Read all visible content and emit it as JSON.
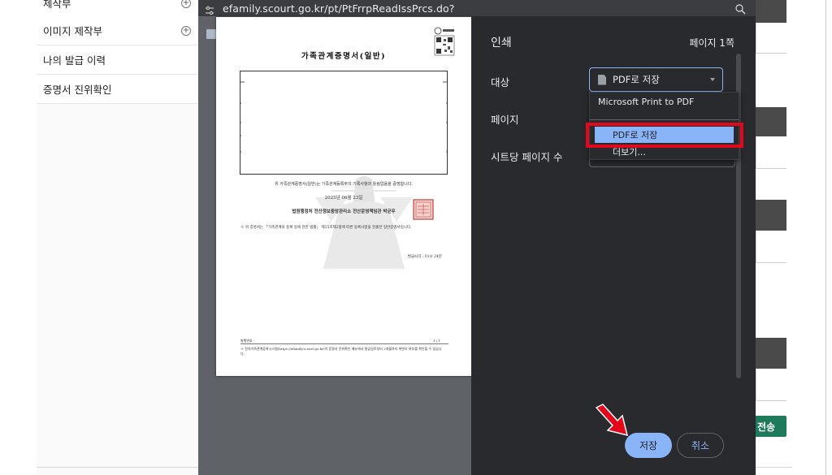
{
  "background": {
    "menu_items": [
      {
        "label": "제작부"
      },
      {
        "label": "이미지 제작부"
      },
      {
        "label": "나의 발급 이력"
      },
      {
        "label": "증명서 진위확인"
      }
    ],
    "send_button": "전송"
  },
  "browser": {
    "url": "efamily.scourt.go.kr/pt/PtFrrpReadIssPrcs.do?"
  },
  "preview": {
    "doc_title": "가족관계증명서(일반)",
    "line_statement": "위 가족관계증명서(일반)는 가족관계등록부의 기록사항과 틀림없음을 증명합니다.",
    "date": "2025년 06월 23일",
    "issuer": "법원행정처 전산정보중앙관리소 전산운영책임관 박균우",
    "note": "※ 위 증명서는 「가족관계의 등록 등에 관한 법률」 제15조제2항에 따른 등록사항을 현출한 일반증명서입니다.",
    "issue_time": "발급시각 : 01시 24분",
    "footer_no": "발행번호 :",
    "footer_page": "1 / 1",
    "footer_note": "※ 전자가족관계등록시스템(https://efamily.scourt.go.kr)의 증명서 진위확인 메뉴에서 발급일로부터 3개월까지 위변조 여부를 확인할 수 있습니다."
  },
  "settings": {
    "title": "인쇄",
    "pages_count": "페이지 1쪽",
    "destination_label": "대상",
    "pages_label": "페이지",
    "pages_per_sheet_label": "시트당 페이지 수",
    "destination_value": "PDF로 저장",
    "dropdown_options": [
      "Microsoft Print to PDF",
      "PDF로 저장",
      "더보기..."
    ],
    "save_button": "저장",
    "cancel_button": "취소"
  },
  "colors": {
    "accent": "#8ab4f8",
    "highlight": "#e3071b",
    "dialog_bg": "#292a2d"
  }
}
